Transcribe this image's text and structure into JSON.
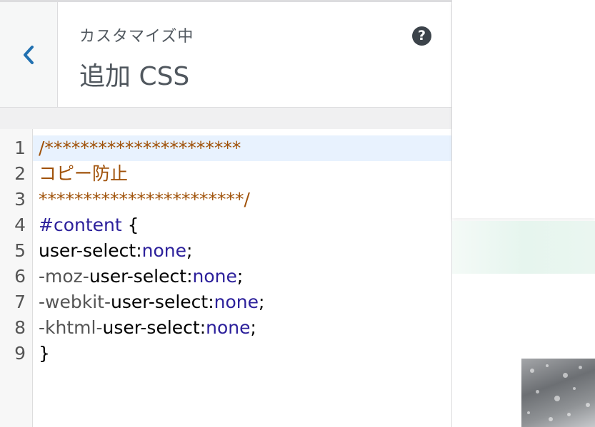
{
  "header": {
    "subtitle": "カスタマイズ中",
    "title": "追加 CSS",
    "help_glyph": "?"
  },
  "icons": {
    "back": "chevron-left-icon",
    "help": "question-circle-icon"
  },
  "colors": {
    "back_chevron": "#2271b1",
    "comment": "#a0520a",
    "keyword": "#2c209b",
    "active_line": "#e8f2fe"
  },
  "editor": {
    "line_numbers": [
      "1",
      "2",
      "3",
      "4",
      "5",
      "6",
      "7",
      "8",
      "9"
    ],
    "lines": [
      {
        "text": "/**********************"
      },
      {
        "text": "コピー防止"
      },
      {
        "text": "***********************/"
      },
      {
        "selector": "#content",
        "brace": " {"
      },
      {
        "prefix": "",
        "prop": "user-select",
        "colon": ":",
        "value": "none",
        "semi": ";"
      },
      {
        "prefix": "-moz-",
        "prop": "user-select",
        "colon": ":",
        "value": "none",
        "semi": ";"
      },
      {
        "prefix": "-webkit-",
        "prop": "user-select",
        "colon": ":",
        "value": "none",
        "semi": ";"
      },
      {
        "prefix": "-khtml-",
        "prop": "user-select",
        "colon": ":",
        "value": "none",
        "semi": ";"
      },
      {
        "text": "}"
      }
    ]
  }
}
